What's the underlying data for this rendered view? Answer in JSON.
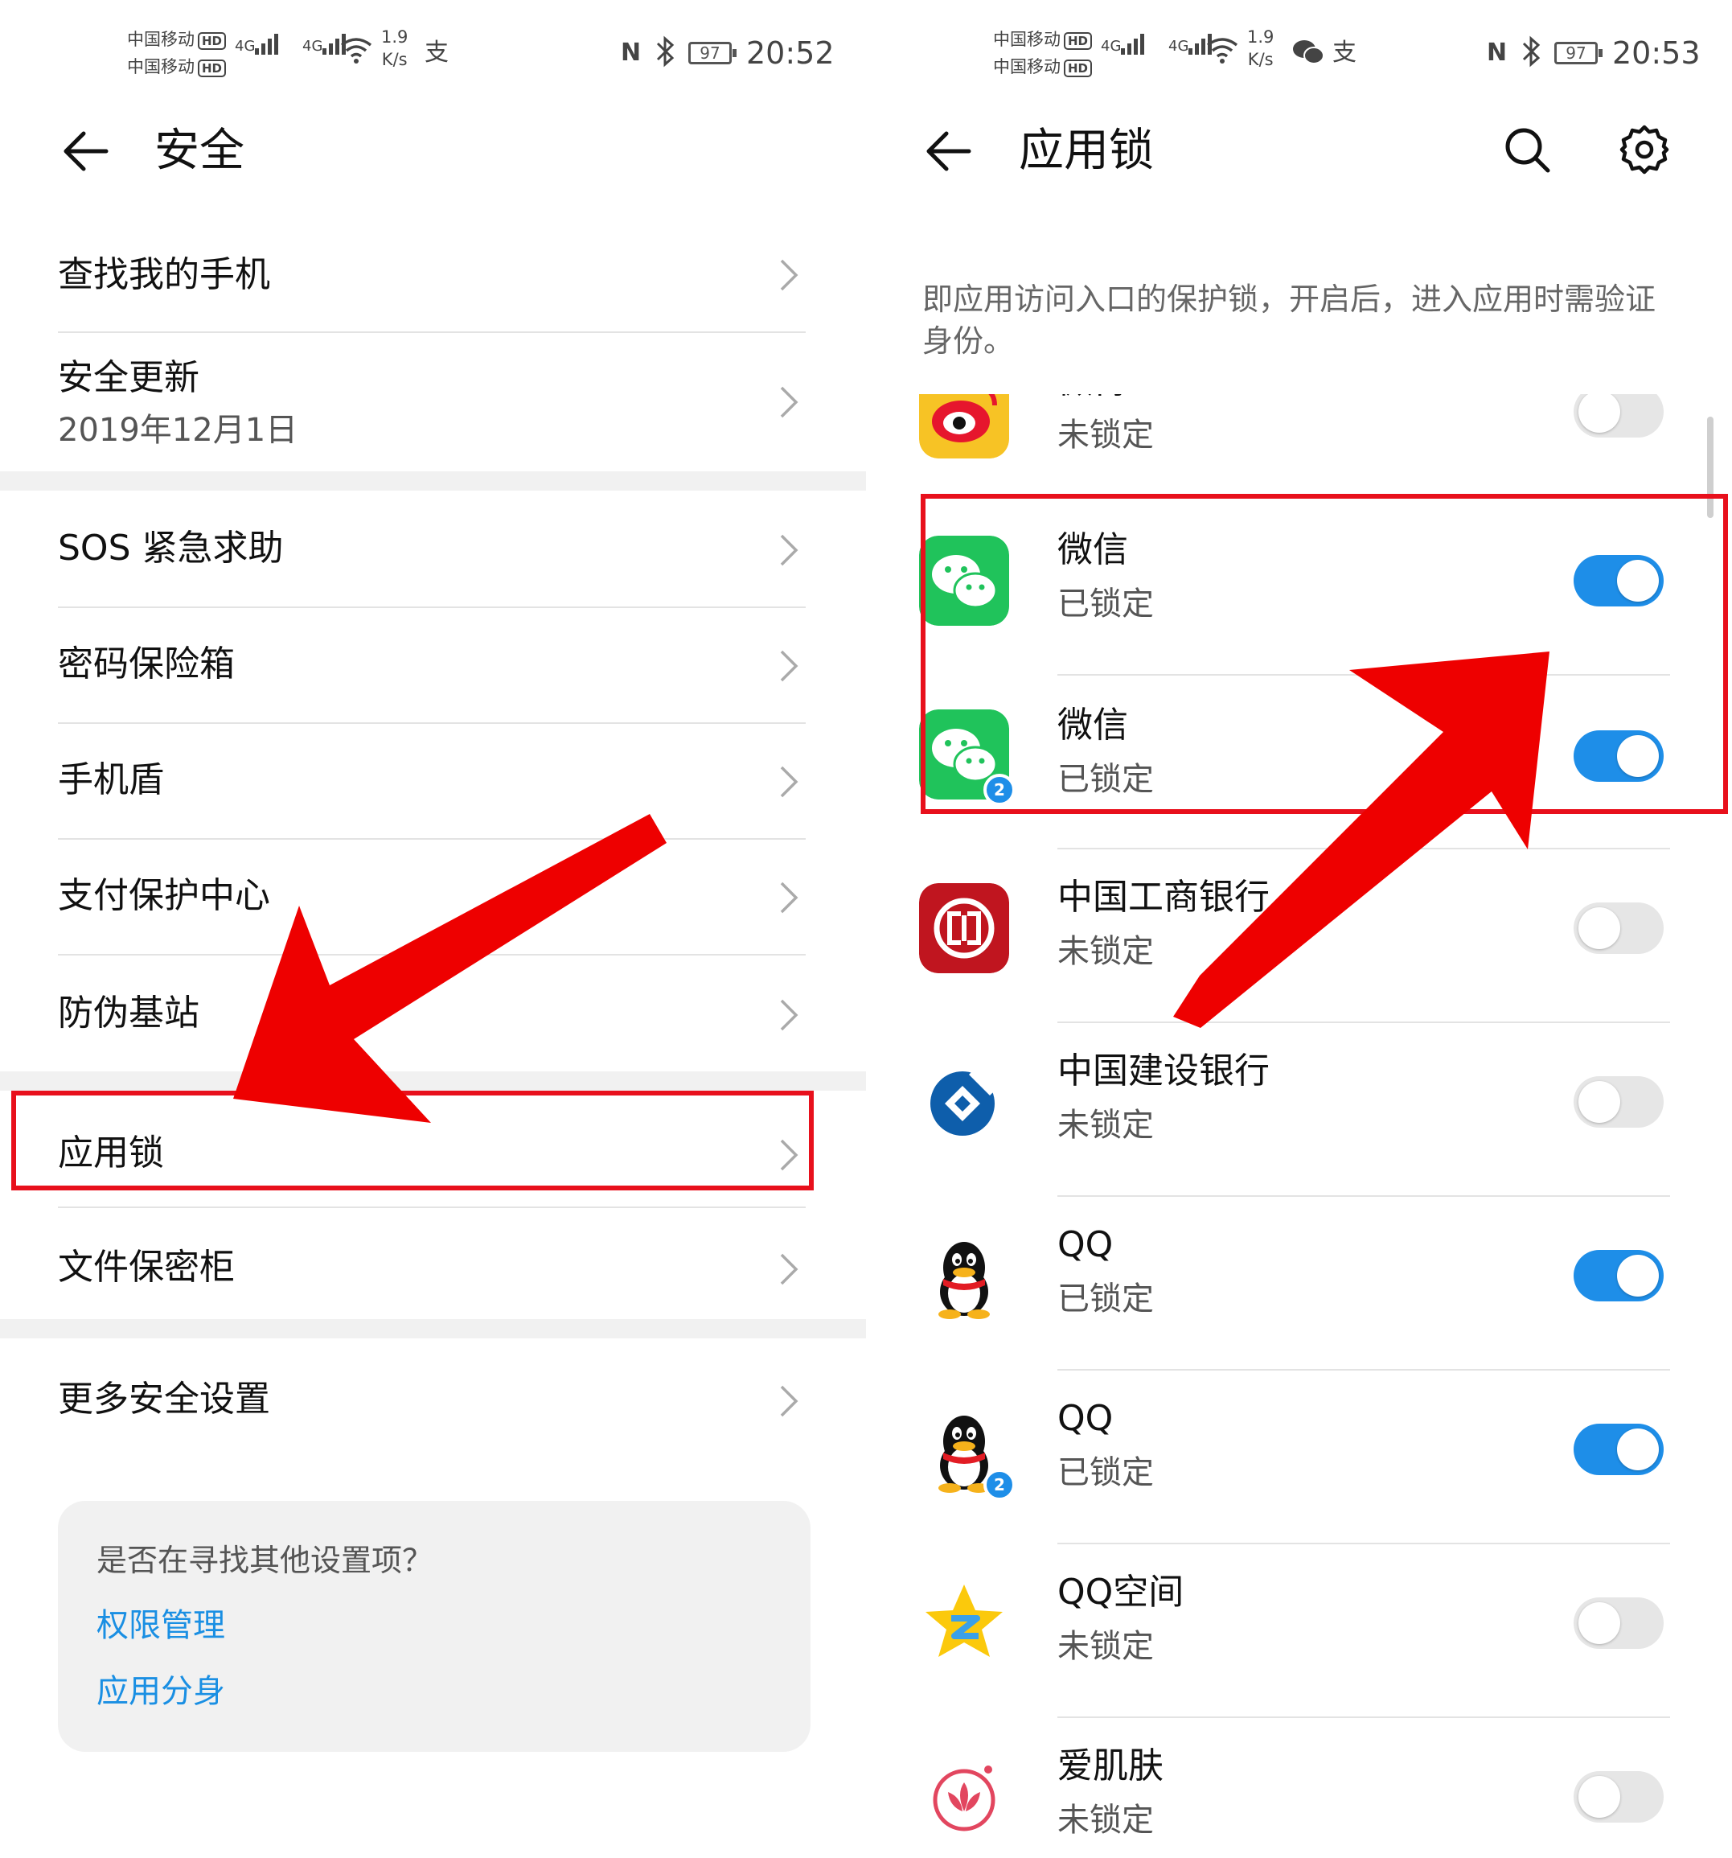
{
  "left": {
    "status": {
      "carrier1": "中国移动",
      "carrier2": "中国移动",
      "hd": "HD",
      "net1": "4G",
      "net2": "4G",
      "speed_value": "1.9",
      "speed_unit": "K/s",
      "battery": "97",
      "time": "20:52"
    },
    "header": {
      "title": "安全"
    },
    "items": [
      {
        "label": "查找我的手机"
      },
      {
        "label": "安全更新",
        "sub": "2019年12月1日"
      },
      {
        "label": "SOS 紧急求助"
      },
      {
        "label": "密码保险箱"
      },
      {
        "label": "手机盾"
      },
      {
        "label": "支付保护中心"
      },
      {
        "label": "防伪基站"
      },
      {
        "label": "应用锁"
      },
      {
        "label": "文件保密柜"
      },
      {
        "label": "更多安全设置"
      }
    ],
    "tip": {
      "question": "是否在寻找其他设置项？",
      "links": [
        "权限管理",
        "应用分身"
      ]
    }
  },
  "right": {
    "status": {
      "carrier1": "中国移动",
      "carrier2": "中国移动",
      "hd": "HD",
      "net1": "4G",
      "net2": "4G",
      "speed_value": "1.9",
      "speed_unit": "K/s",
      "battery": "97",
      "time": "20:53"
    },
    "header": {
      "title": "应用锁",
      "search_icon": "search-icon",
      "settings_icon": "gear-icon"
    },
    "description": "即应用访问入口的保护锁，开启后，进入应用时需验证身份。",
    "apps": [
      {
        "name": "微博",
        "status": "未锁定",
        "locked": false,
        "icon": "weibo-icon"
      },
      {
        "name": "微信",
        "status": "已锁定",
        "locked": true,
        "icon": "wechat-icon"
      },
      {
        "name": "微信",
        "status": "已锁定",
        "locked": true,
        "icon": "wechat-icon",
        "badge": "2"
      },
      {
        "name": "中国工商银行",
        "status": "未锁定",
        "locked": false,
        "icon": "icbc-icon"
      },
      {
        "name": "中国建设银行",
        "status": "未锁定",
        "locked": false,
        "icon": "ccb-icon"
      },
      {
        "name": "QQ",
        "status": "已锁定",
        "locked": true,
        "icon": "qq-icon"
      },
      {
        "name": "QQ",
        "status": "已锁定",
        "locked": true,
        "icon": "qq-icon",
        "badge": "2"
      },
      {
        "name": "QQ空间",
        "status": "未锁定",
        "locked": false,
        "icon": "qzone-icon"
      },
      {
        "name": "爱肌肤",
        "status": "未锁定",
        "locked": false,
        "icon": "aijifu-icon"
      }
    ]
  },
  "colors": {
    "accent": "#1e8ee8",
    "highlight": "#e8101c",
    "link": "#1a8fe3"
  }
}
